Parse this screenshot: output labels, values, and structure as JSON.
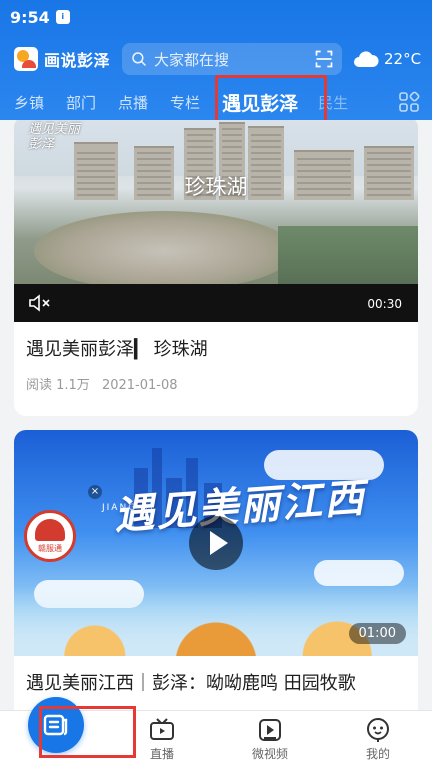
{
  "status_bar": {
    "time": "9:54",
    "app_badge": "i"
  },
  "header": {
    "app_title": "画说彭泽",
    "search_placeholder": "大家都在搜",
    "weather": {
      "temp": "22°C",
      "icon": "cloud-icon"
    }
  },
  "tabs": [
    {
      "label": "乡镇",
      "active": false
    },
    {
      "label": "部门",
      "active": false
    },
    {
      "label": "点播",
      "active": false
    },
    {
      "label": "专栏",
      "active": false
    },
    {
      "label": "遇见彭泽",
      "active": true
    },
    {
      "label": "民生",
      "active": false
    }
  ],
  "feed": [
    {
      "video_title_overlay": "珍珠湖",
      "video_stamp": "遇见美丽彭泽",
      "duration": "00:30",
      "title": "遇见美丽彭泽▎ 珍珠湖",
      "reads": "阅读 1.1万",
      "date": "2021-01-08"
    },
    {
      "calligraphy": "遇见美丽江西",
      "jiangxi_label": "JIANG XI",
      "badge_text": "赣服通",
      "duration": "01:00",
      "title": "遇见美丽江西｜彭泽：呦呦鹿鸣 田园牧歌"
    }
  ],
  "bottom_nav": [
    {
      "label": "",
      "icon": "news-list-icon",
      "active": true
    },
    {
      "label": "直播",
      "icon": "tv-icon"
    },
    {
      "label": "微视频",
      "icon": "video-play-icon"
    },
    {
      "label": "我的",
      "icon": "profile-icon"
    }
  ],
  "colors": {
    "primary": "#1976e6",
    "highlight": "#e53935"
  }
}
